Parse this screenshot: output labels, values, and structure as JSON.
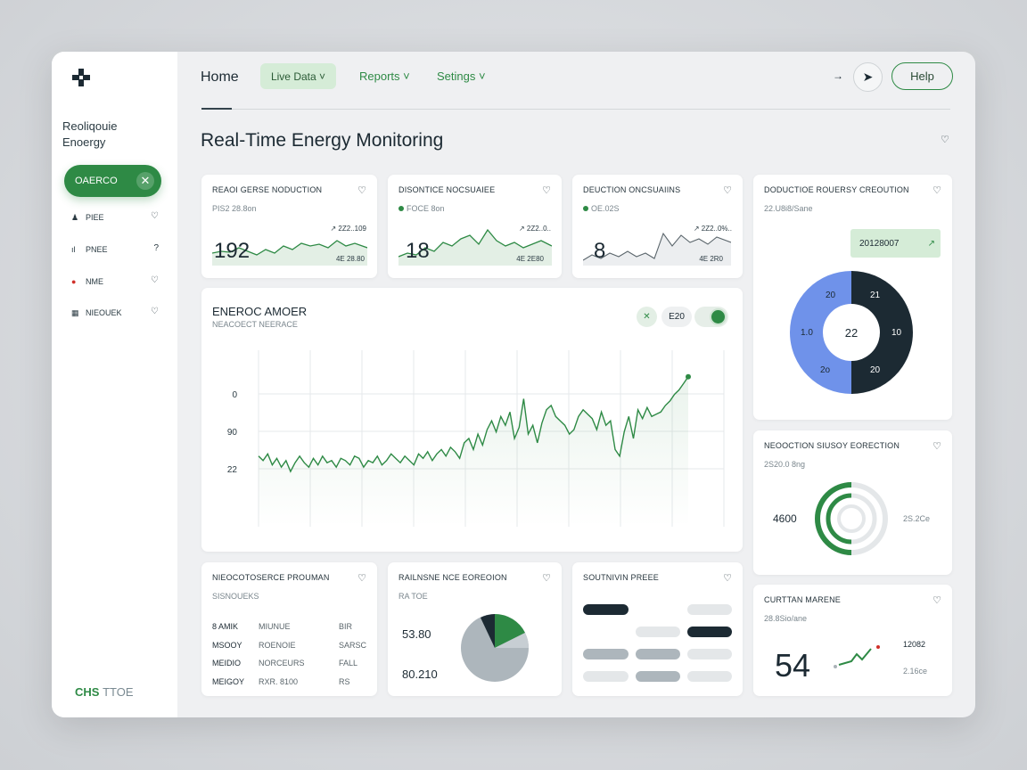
{
  "app": {
    "brand_line1": "Reoliqouie",
    "brand_line2": "Enoergy",
    "footer_bold": "CHS",
    "footer_rest": "TTOE"
  },
  "nav": {
    "active": "OAERCO",
    "items": [
      {
        "label": "PIEE",
        "icon": "person-icon"
      },
      {
        "label": "PNEE",
        "icon": "bars-icon"
      },
      {
        "label": "NME",
        "icon": "pin-icon"
      },
      {
        "label": "NIEOUEK",
        "icon": "grid-icon"
      }
    ]
  },
  "header": {
    "home": "Home",
    "tab_live": "Live Data ˅",
    "tab_reports": "Reports ˅",
    "tab_settings": "Setings ˅",
    "arrow": "→",
    "help": "Help"
  },
  "page_title": "Real-Time Energy Monitoring",
  "kpis": [
    {
      "title": "REAOI GERSE NODUCTION",
      "sub": "PIS2 28.8on",
      "value": "192",
      "delta": "↗ 2Z2..109",
      "foot": "4E 28.80"
    },
    {
      "title": "DISONTICE NOCSUAIEE",
      "sub": "FOCE 8on",
      "value": "18",
      "delta": "↗ 2Z2..0..",
      "foot": "4E 2E80"
    },
    {
      "title": "DEUCTION ONCSUAIINS",
      "sub": "OE.02S",
      "value": "8",
      "delta": "↗ 2Z2..0%..",
      "foot": "4E 2R0"
    }
  ],
  "donut_card": {
    "title": "DODUCTIOE ROUERSY CREOUTION",
    "sub": "22.U8i8/Sane",
    "badge": "20128007",
    "center": "22",
    "labels": [
      "20",
      "1.0",
      "2o",
      "21",
      "10",
      "20"
    ]
  },
  "main_chart": {
    "title": "ENEROC AMOER",
    "sub": "NEACOECT NEERACE",
    "btn_mid": "E20"
  },
  "chart_data": {
    "type": "line",
    "title": "ENEROC AMOER",
    "y_tick_labels": [
      "0",
      "90",
      "22"
    ],
    "series": [
      {
        "values": [
          52,
          50,
          53,
          48,
          51,
          47,
          50,
          45,
          49,
          52,
          49,
          47,
          51,
          48,
          52,
          49,
          50,
          47,
          51,
          50,
          48,
          52,
          51,
          47,
          50,
          49,
          52,
          48,
          50,
          53,
          51,
          49,
          52,
          50,
          48,
          53,
          51,
          54,
          50,
          53,
          55,
          52,
          56,
          54,
          51,
          58,
          60,
          55,
          62,
          57,
          64,
          68,
          63,
          70,
          66,
          72,
          60,
          65,
          78,
          62,
          66,
          58,
          67,
          73,
          75,
          70,
          68,
          66,
          62,
          64,
          70,
          73,
          71,
          69,
          64,
          72,
          66,
          68,
          55,
          52,
          63,
          70,
          60,
          73,
          69,
          74,
          70,
          71,
          72,
          75,
          77,
          80,
          82,
          85,
          88
        ]
      }
    ]
  },
  "ring_card": {
    "title": "NEOOCTION SIUSOY EORECTION",
    "sub": "2S20.0 8ng",
    "left": "4600",
    "right": "2S.2Ce"
  },
  "bottom_left": {
    "title": "NIEOCOTOSERCE PROUMAN",
    "sub": "SISNOUEKS",
    "rows": [
      [
        "8 AMIK",
        "MIUNUE",
        "BIR"
      ],
      [
        "MSOOY",
        "ROENOIE",
        "SARSC"
      ],
      [
        "MEIDIO",
        "NORCEURS",
        "FALL"
      ],
      [
        "MEIGOY",
        "RXR. 8100",
        "RS"
      ]
    ]
  },
  "bottom_pie": {
    "title": "RAILNSNE NCE EOREOION",
    "sub": "RA TOE",
    "v1": "53.80",
    "v2": "80.210"
  },
  "bottom_bars": {
    "title": "SOUTNIVIN PREEE"
  },
  "small_card": {
    "title": "CURTTAN MARENE",
    "sub": "28.8Sio/ane",
    "value": "54",
    "r1": "12082",
    "r2": "2.16ce"
  },
  "colors": {
    "accent": "#2e8a45",
    "blue": "#6f92ea",
    "dark": "#1c2a33"
  }
}
